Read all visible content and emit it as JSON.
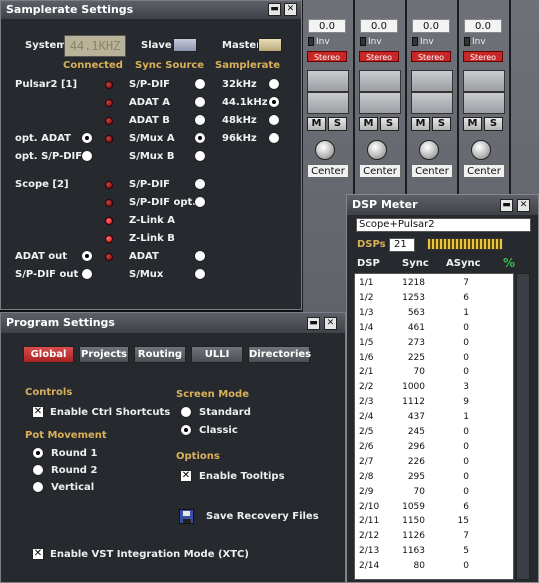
{
  "mixer": {
    "values": [
      "0.0",
      "0.0",
      "0.0",
      "0.0"
    ],
    "inv_label": "Inv",
    "stereo_label": "Stereo",
    "m_label": "M",
    "s_label": "S",
    "pan_label": "Center"
  },
  "samplerate": {
    "title": "Samplerate Settings",
    "system_label": "System",
    "system_display": "44.1KHZ",
    "slave_label": "Slave",
    "master_label": "Master",
    "col_connected": "Connected",
    "col_sync_source": "Sync Source",
    "col_samplerate": "Samplerate",
    "card1": "Pulsar2 [1]",
    "card1_inputs": [
      "opt. ADAT",
      "opt. S/P-DIF"
    ],
    "card1_sources": [
      "S/P-DIF",
      "ADAT A",
      "ADAT B",
      "S/Mux A",
      "S/Mux B"
    ],
    "card2": "Scope [2]",
    "card2_sources": [
      "S/P-DIF",
      "S/P-DIF opt.",
      "Z-Link A",
      "Z-Link B",
      "ADAT",
      "S/Mux"
    ],
    "card2_outputs": [
      "ADAT out",
      "S/P-DIF out"
    ],
    "rates": [
      "32kHz",
      "44.1kHz",
      "48kHz",
      "96kHz"
    ],
    "selected_rate": "44.1kHz"
  },
  "program": {
    "title": "Program Settings",
    "tabs": [
      "Global",
      "Projects",
      "Routing",
      "ULLI",
      "Directories"
    ],
    "active_tab": "Global",
    "controls_heading": "Controls",
    "ctrl_shortcuts": "Enable Ctrl Shortcuts",
    "pot_heading": "Pot Movement",
    "pot_options": [
      "Round 1",
      "Round 2",
      "Vertical"
    ],
    "pot_selected": "Round 1",
    "screen_heading": "Screen Mode",
    "screen_options": [
      "Standard",
      "Classic"
    ],
    "screen_selected": "Classic",
    "options_heading": "Options",
    "tooltips": "Enable Tooltips",
    "save_recovery": "Save Recovery Files",
    "vst_mode": "Enable VST Integration Mode (XTC)"
  },
  "dsp": {
    "title": "DSP Meter",
    "card_field": "Scope+Pulsar2",
    "dsps_label": "DSPs",
    "dsps_value": "21",
    "col_dsp": "DSP",
    "col_sync": "Sync",
    "col_async": "ASync",
    "percent": "%",
    "rows": [
      [
        "1/1",
        "1218",
        "7"
      ],
      [
        "1/2",
        "1253",
        "6"
      ],
      [
        "1/3",
        "563",
        "1"
      ],
      [
        "1/4",
        "461",
        "0"
      ],
      [
        "1/5",
        "273",
        "0"
      ],
      [
        "1/6",
        "225",
        "0"
      ],
      [
        "2/1",
        "70",
        "0"
      ],
      [
        "2/2",
        "1000",
        "3"
      ],
      [
        "2/3",
        "1112",
        "9"
      ],
      [
        "2/4",
        "437",
        "1"
      ],
      [
        "2/5",
        "245",
        "0"
      ],
      [
        "2/6",
        "296",
        "0"
      ],
      [
        "2/7",
        "226",
        "0"
      ],
      [
        "2/8",
        "295",
        "0"
      ],
      [
        "2/9",
        "70",
        "0"
      ],
      [
        "2/10",
        "1059",
        "6"
      ],
      [
        "2/11",
        "1150",
        "15"
      ],
      [
        "2/12",
        "1126",
        "7"
      ],
      [
        "2/13",
        "1163",
        "5"
      ],
      [
        "2/14",
        "80",
        "0"
      ]
    ]
  },
  "colors": {
    "accent_red": "#c62828",
    "label_gold": "#d8b15a",
    "led_on": "#d01818"
  }
}
